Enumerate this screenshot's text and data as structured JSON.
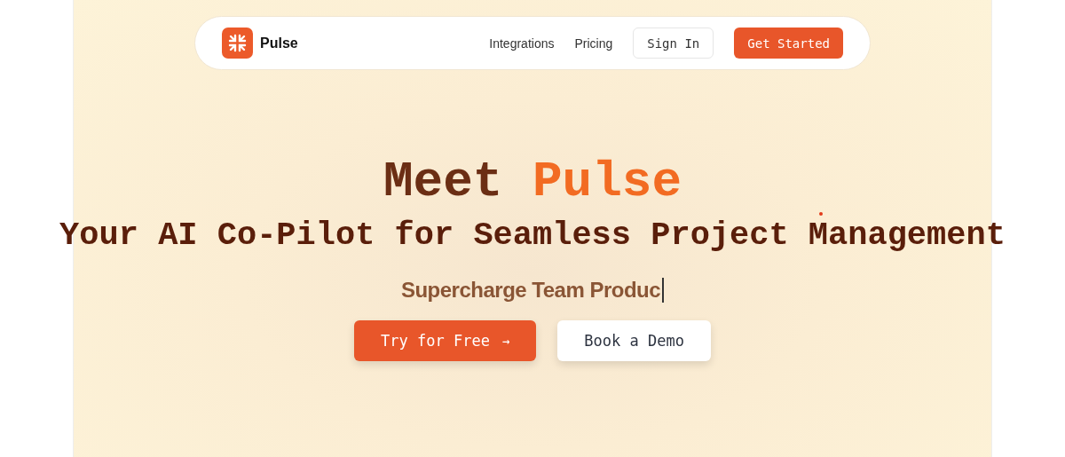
{
  "nav": {
    "brand": "Pulse",
    "links": [
      "Integrations",
      "Pricing"
    ],
    "sign_in": "Sign In",
    "cta": "Get Started"
  },
  "hero": {
    "title": [
      {
        "text": "Meet ",
        "kind": "plain"
      },
      {
        "text": "Pulse",
        "kind": "accent"
      }
    ],
    "subtitle": "Your AI Co-Pilot for Seamless Project Management",
    "typed": "Supercharge Team Produc",
    "buttons": [
      {
        "label": "Try for Free",
        "kind": "primary",
        "arrow": "→"
      },
      {
        "label": "Book a Demo",
        "kind": "secondary"
      }
    ]
  }
}
